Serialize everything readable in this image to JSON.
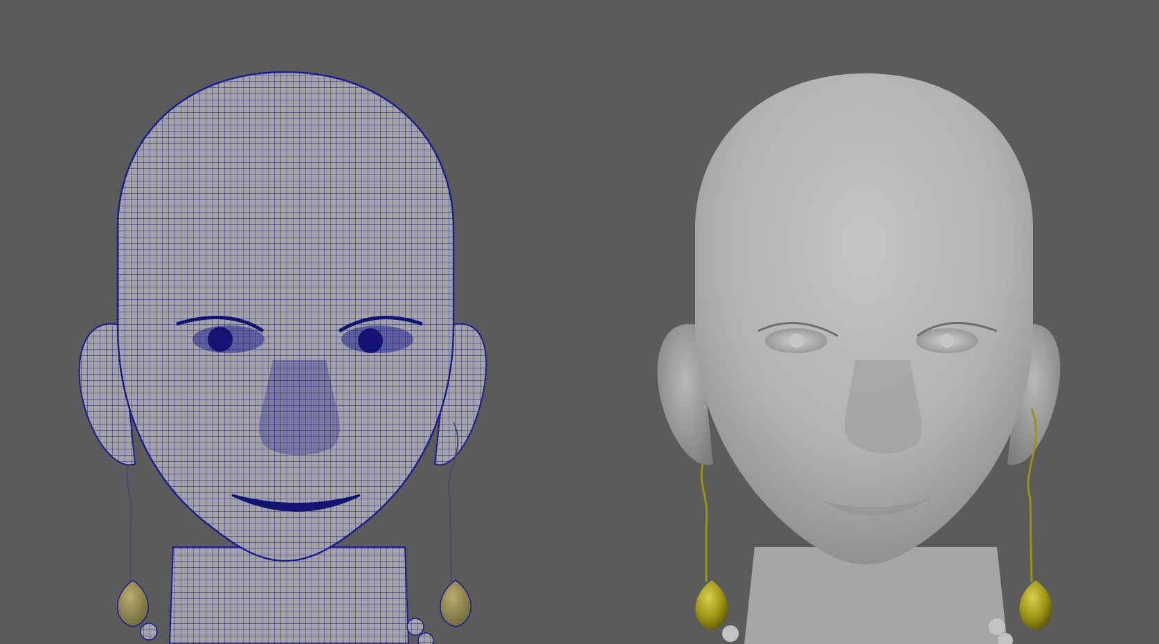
{
  "viewport": {
    "background": "#5b5b5b"
  },
  "models": [
    {
      "name": "wireframe-head",
      "shading": "wireframe",
      "wire_color": "#1a1a8c",
      "surface_color": "#a9a9a9",
      "earring_color": "#8f8a4a"
    },
    {
      "name": "smooth-shaded-head",
      "shading": "smooth",
      "surface_color": "#b9b9b9",
      "earring_color": "#9a9410"
    }
  ]
}
